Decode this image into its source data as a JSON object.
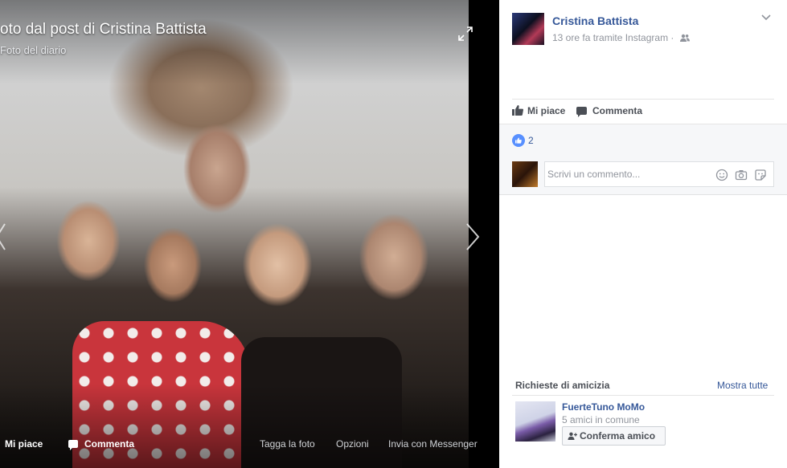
{
  "photo_viewer": {
    "title": "oto dal post di Cristina Battista",
    "subtitle": "Foto del diario",
    "actions": {
      "like": "Mi piace",
      "comment": "Commenta",
      "tag_photo": "Tagga la foto",
      "options": "Opzioni",
      "send_messenger": "Invia con Messenger"
    }
  },
  "post": {
    "author": "Cristina Battista",
    "meta": "13 ore fa tramite Instagram ·",
    "actions": {
      "like": "Mi piace",
      "comment": "Commenta"
    },
    "like_count": "2",
    "comment_placeholder": "Scrivi un commento..."
  },
  "friend_requests": {
    "header": "Richieste di amicizia",
    "see_all": "Mostra tutte",
    "items": [
      {
        "name": "FuerteTuno MoMo",
        "mutual": "5 amici in comune",
        "confirm_label": "Conferma amico"
      }
    ]
  },
  "colors": {
    "link_blue": "#365899",
    "like_blue": "#5890ff",
    "muted_text": "#90949c"
  }
}
